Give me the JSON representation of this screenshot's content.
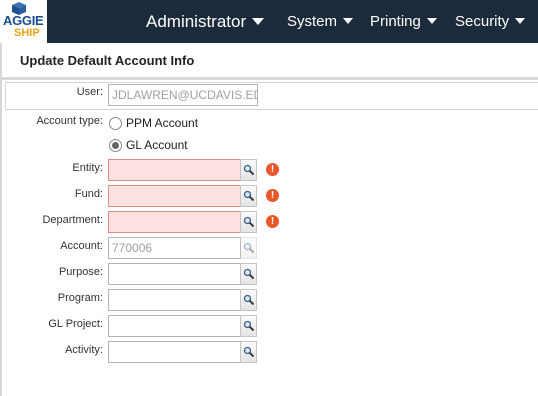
{
  "brand": {
    "line1": "AGGIE",
    "line2": "SHIP",
    "colors": {
      "primary": "#1b4f8e",
      "accent": "#e7a417"
    }
  },
  "nav": {
    "items": [
      {
        "label": "Administrator"
      },
      {
        "label": "System"
      },
      {
        "label": "Printing"
      },
      {
        "label": "Security"
      }
    ],
    "background": "#1c2b3b"
  },
  "page": {
    "title": "Update Default Account Info"
  },
  "form": {
    "user": {
      "label": "User:",
      "value": "JDLAWREN@UCDAVIS.EDU"
    },
    "account_type": {
      "label": "Account type:",
      "options": [
        {
          "label": "PPM Account",
          "selected": false
        },
        {
          "label": "GL Account",
          "selected": true
        }
      ]
    },
    "entity": {
      "label": "Entity:",
      "value": "",
      "error": true
    },
    "fund": {
      "label": "Fund:",
      "value": "",
      "error": true
    },
    "department": {
      "label": "Department:",
      "value": "",
      "error": true
    },
    "account": {
      "label": "Account:",
      "value": "770006",
      "readonly": true
    },
    "purpose": {
      "label": "Purpose:",
      "value": ""
    },
    "program": {
      "label": "Program:",
      "value": ""
    },
    "gl_project": {
      "label": "GL Project:",
      "value": ""
    },
    "activity": {
      "label": "Activity:",
      "value": ""
    },
    "error_icon": "!",
    "icons": {
      "lookup": "magnifier-icon",
      "error": "error-icon"
    },
    "error_color": "#e8582a"
  }
}
